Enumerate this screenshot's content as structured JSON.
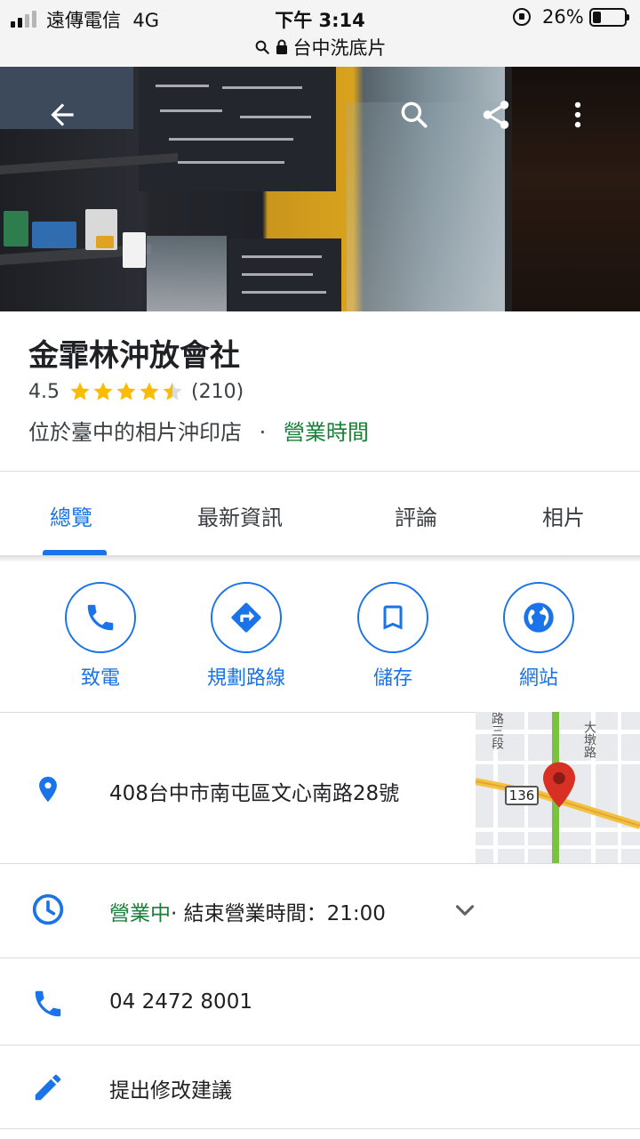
{
  "status_bar": {
    "carrier": "遠傳電信",
    "network": "4G",
    "time": "下午 3:14",
    "battery_percent": "26%",
    "battery_level": 0.26
  },
  "browser": {
    "url_text": "台中洗底片"
  },
  "place": {
    "name": "金霏林沖放會社",
    "rating": "4.5",
    "stars": 4.5,
    "review_count": "(210)",
    "category": "位於臺中的相片沖印店",
    "separator": "·",
    "hours_link": "營業時間"
  },
  "tabs": [
    {
      "label": "總覽",
      "active": true
    },
    {
      "label": "最新資訊",
      "active": false
    },
    {
      "label": "評論",
      "active": false
    },
    {
      "label": "相片",
      "active": false
    }
  ],
  "actions": [
    {
      "label": "致電",
      "icon": "phone-icon"
    },
    {
      "label": "規劃路線",
      "icon": "directions-icon"
    },
    {
      "label": "儲存",
      "icon": "bookmark-icon"
    },
    {
      "label": "網站",
      "icon": "globe-icon"
    }
  ],
  "info": {
    "address": "408台中市南屯區文心南路28號",
    "hours_status": "營業中",
    "hours_detail": "· 結束營業時間：21:00",
    "phone": "04 2472 8001",
    "suggest_edit": "提出修改建議"
  },
  "map": {
    "route_number": "136",
    "road_label_1": "大墩路",
    "road_label_2": "路三段"
  },
  "colors": {
    "accent": "#1a73e8",
    "open_green": "#188038",
    "star": "#fbbc04",
    "pin": "#d93025"
  }
}
